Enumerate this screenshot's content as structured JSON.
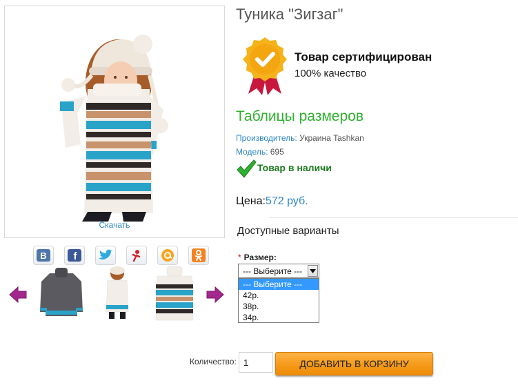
{
  "gallery": {
    "download_label": "Скачать"
  },
  "social": {
    "items": [
      "vk-icon",
      "facebook-icon",
      "twitter-icon",
      "odnoklassniki-alt-icon",
      "mailru-icon",
      "odnoklassniki-icon"
    ]
  },
  "product": {
    "title": "Туника \"Зигзаг\"",
    "certified_title": "Товар сертифицирован",
    "certified_subtitle": "100% качество",
    "size_table_link": "Таблицы размеров",
    "manufacturer_label": "Производитель:",
    "manufacturer_value": "Украина Tashkan",
    "model_label": "Модель:",
    "model_value": "695",
    "stock_status": "Товар в наличи",
    "price_label": "Цена:",
    "price_value": "572 руб."
  },
  "options": {
    "title": "Доступные варианты",
    "required_mark": "*",
    "size_label": "Размер:",
    "select_value": "--- Выберите ---",
    "dropdown_options": [
      "--- Выберите ---",
      "42р.",
      "38р.",
      "34р."
    ]
  },
  "cart": {
    "quantity_label": "Количество:",
    "quantity_value": "1",
    "add_button_label": "ДОБАВИТЬ В КОРЗИНУ"
  },
  "colors": {
    "link_blue": "#2e87c6",
    "green_link": "#2fb12f",
    "stock_green": "#1c7a1c",
    "button_orange": "#f49a19",
    "badge_gold": "#f6b21b",
    "ribbon_red": "#c8183d"
  }
}
